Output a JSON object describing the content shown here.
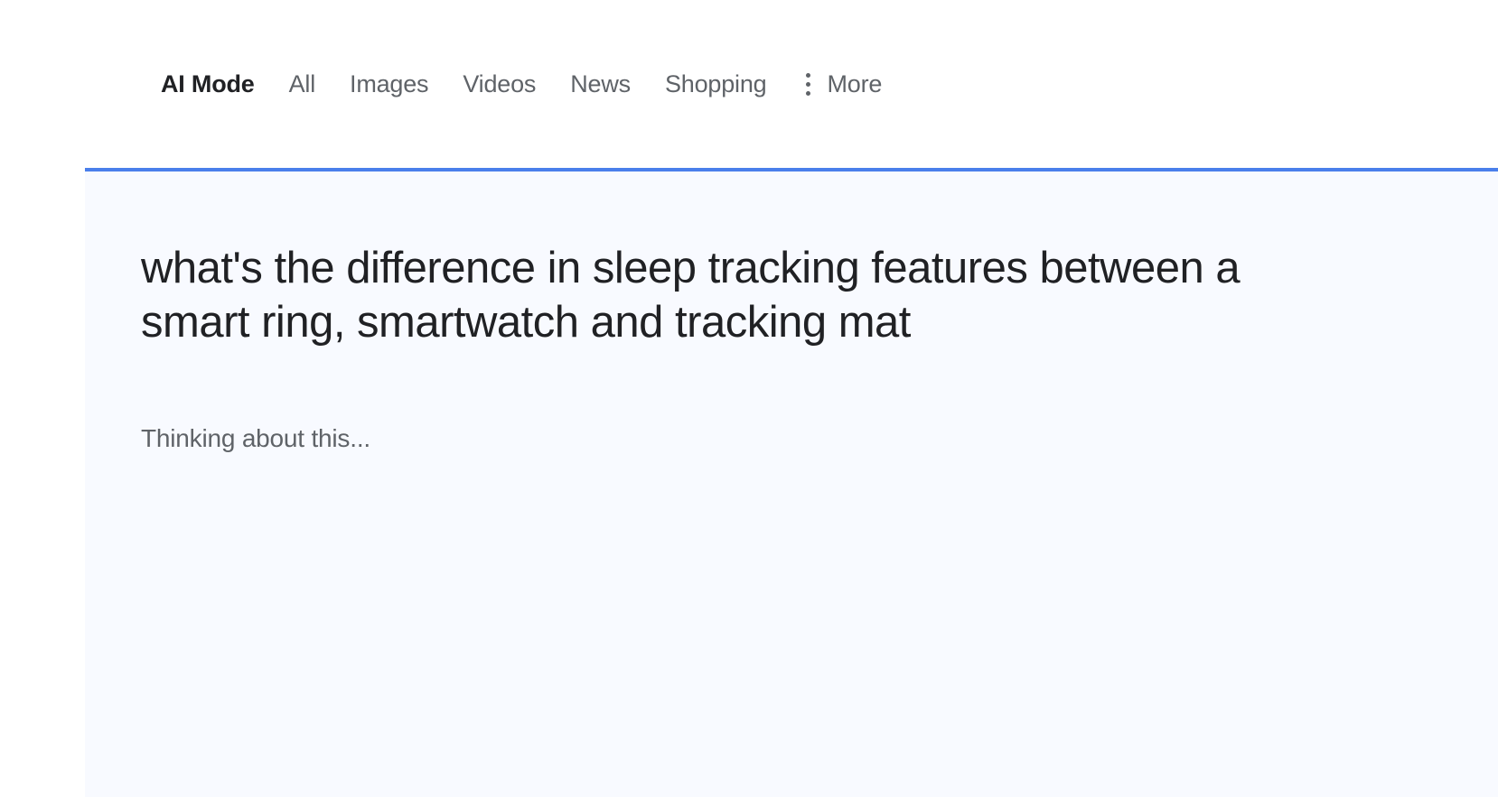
{
  "tabs": {
    "items": [
      {
        "label": "AI Mode",
        "active": true
      },
      {
        "label": "All",
        "active": false
      },
      {
        "label": "Images",
        "active": false
      },
      {
        "label": "Videos",
        "active": false
      },
      {
        "label": "News",
        "active": false
      },
      {
        "label": "Shopping",
        "active": false
      }
    ],
    "more_label": "More"
  },
  "content": {
    "query": "what's the difference in sleep tracking features between a smart ring, smartwatch and tracking mat",
    "status": "Thinking about this..."
  },
  "colors": {
    "accent": "#4a7feb",
    "text_primary": "#202124",
    "text_secondary": "#5f6368",
    "content_bg": "#f8faff"
  }
}
